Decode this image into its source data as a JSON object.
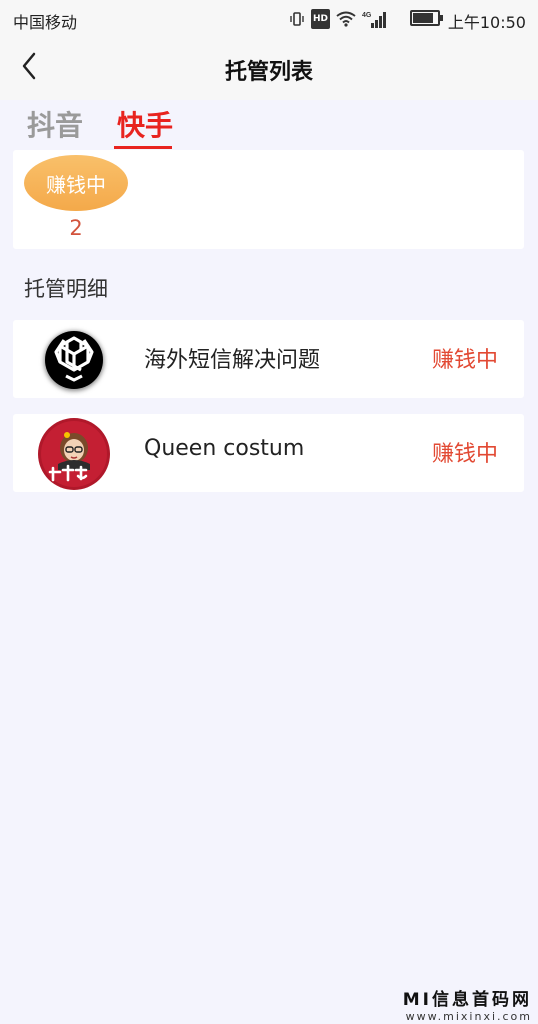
{
  "status_bar": {
    "carrier": "中国移动",
    "hd_badge": "HD",
    "network": "4G",
    "time": "上午10:50",
    "battery_level": 0.9
  },
  "header": {
    "title": "托管列表",
    "back_icon": "chevron-left-icon"
  },
  "tabs": [
    {
      "label": "抖音",
      "active": false
    },
    {
      "label": "快手",
      "active": true
    }
  ],
  "summary": {
    "status_label": "赚钱中",
    "count": "2"
  },
  "section_title": "托管明细",
  "items": [
    {
      "title": "海外短信解决问题",
      "status": "赚钱中",
      "logo": "knot-logo-icon"
    },
    {
      "title": "Queen costum",
      "status": "赚钱中",
      "logo": "queen-avatar-logo"
    }
  ],
  "watermark": {
    "main": "MI信息首码网",
    "url": "www.mixinxi.com"
  },
  "colors": {
    "accent": "#e8231f",
    "status_text": "#e24933",
    "pill_orange": "#f4a94a",
    "background": "#f4f4fd"
  }
}
